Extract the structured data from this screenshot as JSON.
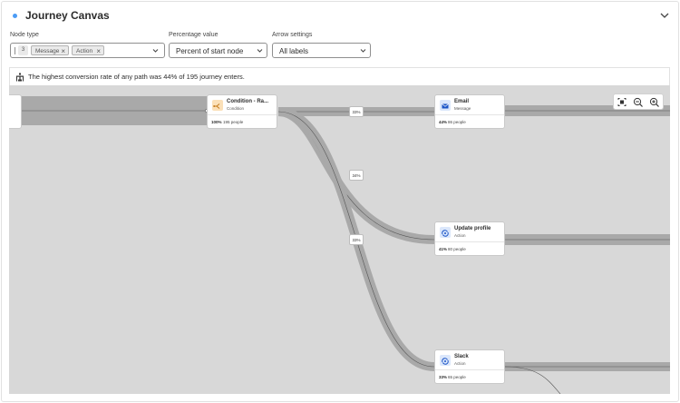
{
  "header": {
    "title": "Journey Canvas"
  },
  "controls": {
    "node_type": {
      "label": "Node type",
      "count": "3",
      "tags": [
        "Message",
        "Action"
      ]
    },
    "percentage_value": {
      "label": "Percentage value",
      "value": "Percent of start node"
    },
    "arrow_settings": {
      "label": "Arrow settings",
      "value": "All labels"
    }
  },
  "banner": {
    "text": "The highest conversion rate of any path was 44% of 195 journey enters."
  },
  "nodes": [
    {
      "name": "Condition - Ra...",
      "type": "Condition",
      "percent": "100%",
      "people": "195 people",
      "icon": "condition-icon",
      "icon_color": "#fbe0b8"
    },
    {
      "name": "Email",
      "type": "Message",
      "percent": "44%",
      "people": "86 people",
      "icon": "email-icon",
      "icon_color": "#dbe7fb"
    },
    {
      "name": "Update profile",
      "type": "Action",
      "percent": "41%",
      "people": "80 people",
      "icon": "action-icon",
      "icon_color": "#dbe7fb"
    },
    {
      "name": "Slack",
      "type": "Action",
      "percent": "33%",
      "people": "65 people",
      "icon": "action-icon",
      "icon_color": "#dbe7fb"
    }
  ],
  "path_labels": [
    "33%",
    "34%",
    "33%"
  ],
  "colors": {
    "accent": "#4b9cf5",
    "canvas": "#d8d8d8",
    "flow": "#a9a9a9"
  }
}
